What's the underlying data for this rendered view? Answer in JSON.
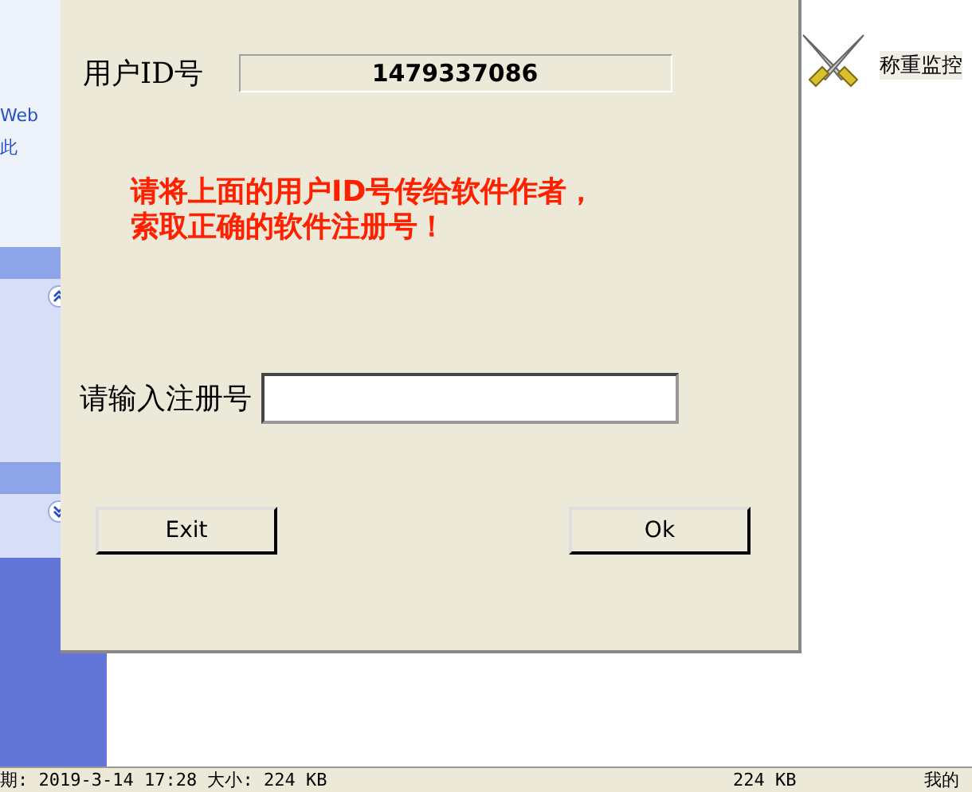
{
  "sidebar": {
    "texts": [
      "Web",
      "此"
    ],
    "sections": [
      {
        "expanded": true
      },
      {
        "expanded": false
      }
    ]
  },
  "desktop_item": {
    "label": "称重监控"
  },
  "dialog": {
    "id_label": "用户ID号",
    "id_value": "1479337086",
    "message": "请将上面的用户ID号传给软件作者，索取正确的软件注册号！",
    "input_label": "请输入注册号",
    "buttons": [
      "Exit",
      "Ok"
    ]
  },
  "status_bar": {
    "left": "期: 2019-3-14 17:28 大小: 224 KB",
    "middle": "224 KB",
    "right": "我的"
  }
}
